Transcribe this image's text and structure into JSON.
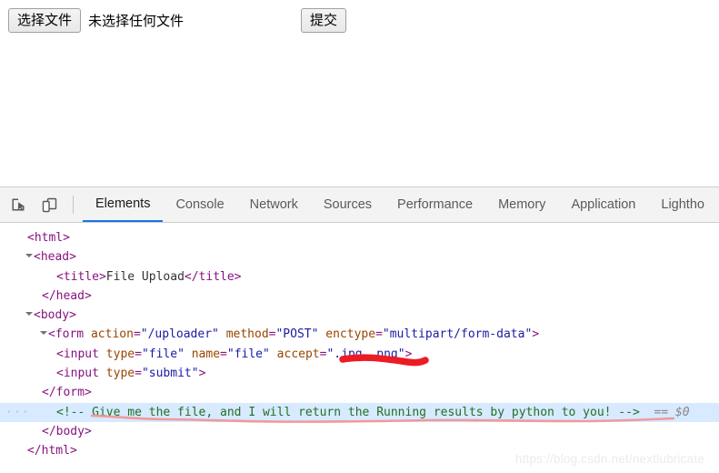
{
  "page": {
    "file_input": {
      "button_label": "选择文件",
      "status_text": "未选择任何文件"
    },
    "submit_button_label": "提交"
  },
  "devtools": {
    "icons": [
      {
        "name": "inspect-element-icon",
        "title": "Inspect element"
      },
      {
        "name": "device-toolbar-icon",
        "title": "Toggle device toolbar"
      }
    ],
    "tabs": [
      {
        "label": "Elements",
        "active": true
      },
      {
        "label": "Console",
        "active": false
      },
      {
        "label": "Network",
        "active": false
      },
      {
        "label": "Sources",
        "active": false
      },
      {
        "label": "Performance",
        "active": false
      },
      {
        "label": "Memory",
        "active": false
      },
      {
        "label": "Application",
        "active": false
      },
      {
        "label": "Lightho",
        "active": false
      }
    ],
    "active_tab_accent": "#1a73e8",
    "selected_row_background": "#d7eaff",
    "code": {
      "line_html_open": "<html>",
      "line_head_open": "<head>",
      "title_open": "<title>",
      "title_text": "File Upload",
      "title_close": "</title>",
      "line_head_close": "</head>",
      "line_body_open": "<body>",
      "form_tag": "<form",
      "form_attr1_name": "action",
      "form_attr1_value": "\"/uploader\"",
      "form_attr2_name": "method",
      "form_attr2_value": "\"POST\"",
      "form_attr3_name": "enctype",
      "form_attr3_value": "\"multipart/form-data\"",
      "form_close_bracket": ">",
      "input_file_tag": "<input",
      "input_file_attr1_name": "type",
      "input_file_attr1_value": "\"file\"",
      "input_file_attr2_name": "name",
      "input_file_attr2_value": "\"file\"",
      "input_file_attr3_name": "accept",
      "input_file_attr3_value": "\".jpg,.png\"",
      "input_file_close_bracket": ">",
      "input_submit_tag": "<input",
      "input_submit_attr1_name": "type",
      "input_submit_attr1_value": "\"submit\"",
      "input_submit_close_bracket": ">",
      "line_form_close": "</form>",
      "ellipsis_marker": "···",
      "comment_text": "<!-- Give me the file, and I will return the Running results by python to you! -->",
      "selected_node_ref": "== $0",
      "line_body_close": "</body>",
      "line_html_close": "</html>"
    }
  },
  "annotations": {
    "red_underline_color": "#ec1c24",
    "pink_underline_color": "#f09a9a",
    "red_underline_target": ".jpg,.png",
    "pink_underline_target": "comment line"
  },
  "watermark": {
    "text": "https://blog.csdn.net/nextlubricate"
  }
}
